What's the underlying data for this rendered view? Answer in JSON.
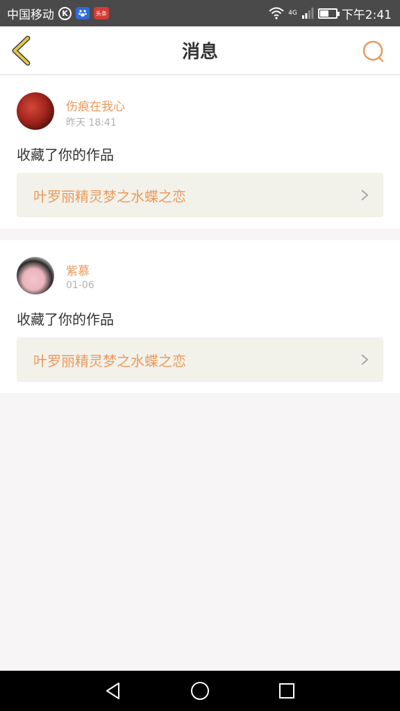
{
  "status_bar": {
    "carrier": "中国移动",
    "icons": [
      "k-icon",
      "baidu-icon",
      "toutiao-icon"
    ],
    "toutiao_label": "头条",
    "network": "4G",
    "battery_level": 0.55,
    "time": "下午2:41"
  },
  "header": {
    "title": "消息",
    "back_icon": "chevron-left-icon",
    "search_icon": "search-icon"
  },
  "messages": [
    {
      "user": "伤痕在我心",
      "time": "昨天 18:41",
      "action": "收藏了你的作品",
      "work_title": "叶罗丽精灵梦之水蝶之恋"
    },
    {
      "user": "紫慕",
      "time": "01-06",
      "action": "收藏了你的作品",
      "work_title": "叶罗丽精灵梦之水蝶之恋"
    }
  ],
  "colors": {
    "accent": "#e99a5e",
    "back_icon": "#d4b838",
    "link_bg": "#f3f2ea",
    "page_bg": "#f7f5f5"
  },
  "nav_bar": {
    "icons": [
      "back-triangle-icon",
      "home-circle-icon",
      "recents-square-icon"
    ]
  }
}
